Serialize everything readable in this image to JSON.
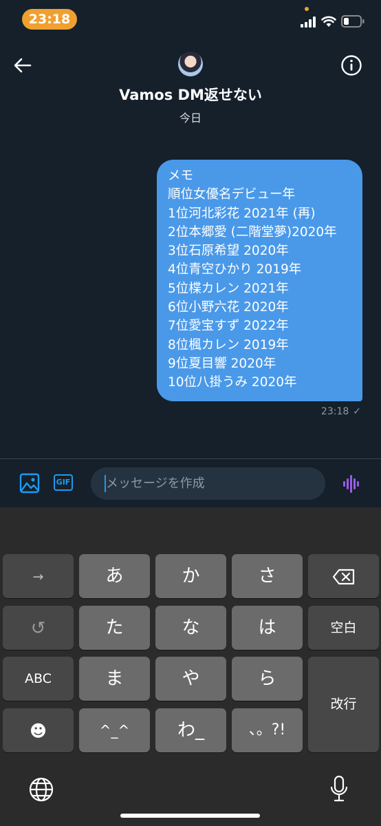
{
  "status_bar": {
    "time": "23:18"
  },
  "header": {
    "title": "Vamos DM返せない",
    "date": "今日"
  },
  "message": {
    "lines": [
      "メモ",
      "順位女優名デビュー年",
      "1位河北彩花 2021年 (再)",
      "2位本郷愛 (二階堂夢)2020年",
      "3位石原希望 2020年",
      "4位青空ひかり 2019年",
      "5位楪カレン 2021年",
      "6位小野六花 2020年",
      "7位愛宝すず 2022年",
      "8位楓カレン 2019年",
      "9位夏目響 2020年",
      "10位八掛うみ 2020年"
    ],
    "time": "23:18",
    "status": "✓"
  },
  "composer": {
    "gif_label": "GIF",
    "placeholder": "メッセージを作成"
  },
  "keyboard": {
    "rows": [
      [
        "→",
        "あ",
        "か",
        "さ",
        "⌫"
      ],
      [
        "↺",
        "た",
        "な",
        "は",
        "空白"
      ],
      [
        "ABC",
        "ま",
        "や",
        "ら",
        "改行"
      ],
      [
        "☻",
        "^_^",
        "わ_",
        "、。?!"
      ]
    ]
  },
  "colors": {
    "background": "#15202b",
    "bubble": "#4a99e9",
    "accent": "#1d9bf0",
    "time_pill": "#f0a030"
  }
}
